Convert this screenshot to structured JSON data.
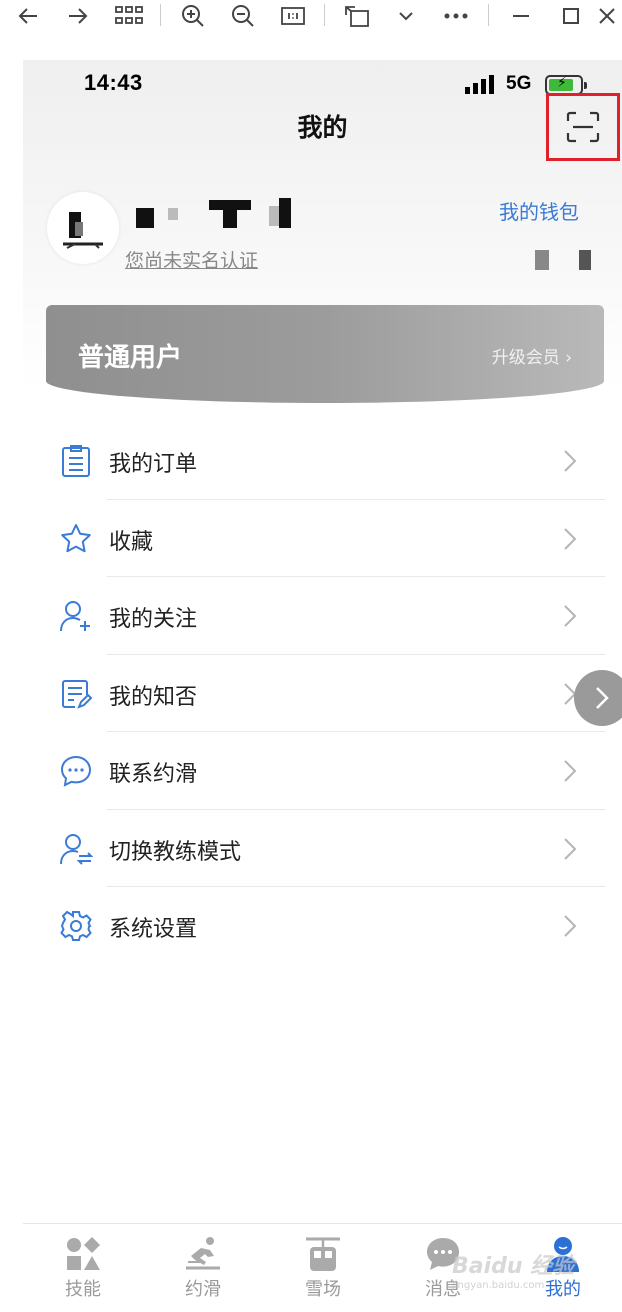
{
  "status_bar": {
    "time": "14:43",
    "network": "5G"
  },
  "header": {
    "title": "我的"
  },
  "profile": {
    "realname_prompt": "您尚未实名认证",
    "wallet_label": "我的钱包"
  },
  "member_card": {
    "level": "普通用户",
    "upgrade_label": "升级会员 ›"
  },
  "menu": {
    "items": [
      {
        "label": "我的订单",
        "icon": "order-list-icon"
      },
      {
        "label": "收藏",
        "icon": "star-icon"
      },
      {
        "label": "我的关注",
        "icon": "add-user-icon"
      },
      {
        "label": "我的知否",
        "icon": "note-icon"
      },
      {
        "label": "联系约滑",
        "icon": "chat-bubble-icon"
      },
      {
        "label": "切换教练模式",
        "icon": "switch-user-icon"
      },
      {
        "label": "系统设置",
        "icon": "gear-icon"
      }
    ]
  },
  "tabbar": {
    "items": [
      {
        "label": "技能",
        "icon": "skills-icon"
      },
      {
        "label": "约滑",
        "icon": "skier-icon"
      },
      {
        "label": "雪场",
        "icon": "cable-car-icon"
      },
      {
        "label": "消息",
        "icon": "message-icon"
      },
      {
        "label": "我的",
        "icon": "profile-icon",
        "active": true
      }
    ]
  },
  "colors": {
    "accent": "#2c70d6",
    "link": "#3a7bd5",
    "highlight": "#e0202a",
    "card": "#9c9c9c"
  },
  "watermark": {
    "brand": "Baidu 经验",
    "site": "jingyan.baidu.com"
  }
}
